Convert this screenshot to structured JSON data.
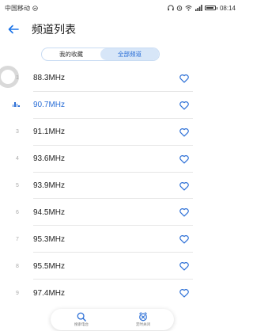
{
  "status_bar": {
    "carrier": "中国移动",
    "time": "08:14"
  },
  "header": {
    "back_icon": "back-arrow-icon",
    "title": "频道列表"
  },
  "tabs": [
    {
      "label": "我的收藏",
      "active": false
    },
    {
      "label": "全部频道",
      "active": true
    }
  ],
  "channels": [
    {
      "index": "1",
      "freq": "88.3MHz",
      "playing": false
    },
    {
      "index": "",
      "freq": "90.7MHz",
      "playing": true
    },
    {
      "index": "3",
      "freq": "91.1MHz",
      "playing": false
    },
    {
      "index": "4",
      "freq": "93.6MHz",
      "playing": false
    },
    {
      "index": "5",
      "freq": "93.9MHz",
      "playing": false
    },
    {
      "index": "6",
      "freq": "94.5MHz",
      "playing": false
    },
    {
      "index": "7",
      "freq": "95.3MHz",
      "playing": false
    },
    {
      "index": "8",
      "freq": "95.5MHz",
      "playing": false
    },
    {
      "index": "9",
      "freq": "97.4MHz",
      "playing": false
    }
  ],
  "bottom_bar": {
    "search_label": "搜索电台",
    "timer_label": "定时关闭"
  },
  "colors": {
    "accent": "#2a6ed6",
    "tab_active_bg": "#d7e6f8",
    "heart": "#2a6ed6"
  }
}
